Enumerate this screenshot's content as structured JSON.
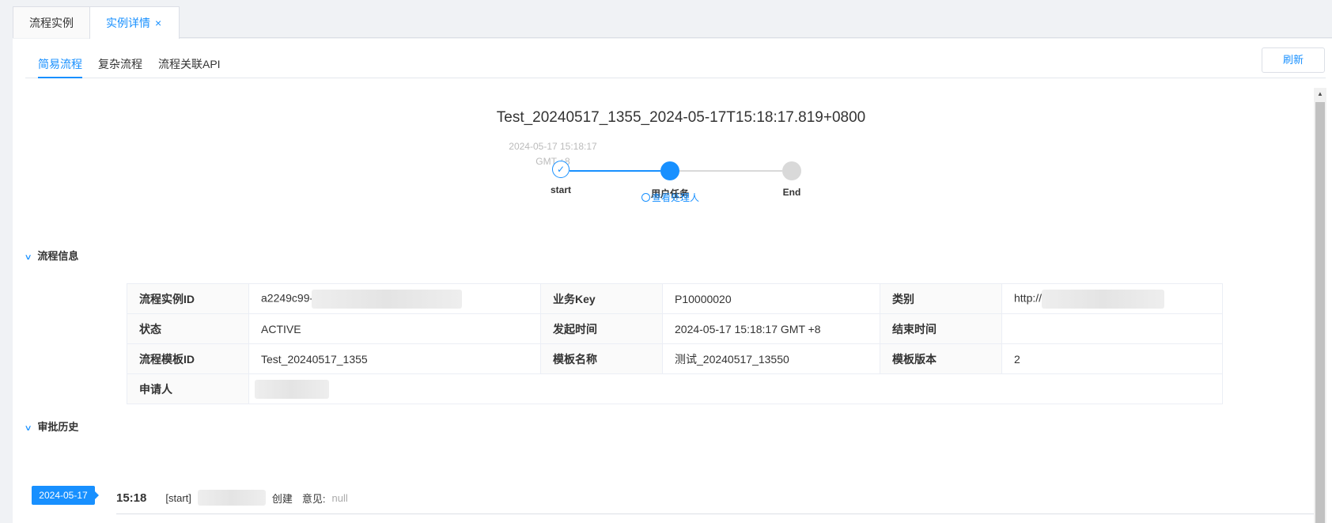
{
  "top_tabs": [
    {
      "label": "流程实例"
    },
    {
      "label": "实例详情",
      "close": "×"
    }
  ],
  "sub_tabs": [
    {
      "label": "简易流程"
    },
    {
      "label": "复杂流程"
    },
    {
      "label": "流程关联API"
    }
  ],
  "refresh_label": "刷新",
  "flow": {
    "title": "Test_20240517_1355_2024-05-17T15:18:17.819+0800",
    "start_time": "2024-05-17 15:18:17 GMT +8",
    "nodes": [
      {
        "label": "start",
        "status": "done"
      },
      {
        "label": "用户任务",
        "status": "active"
      },
      {
        "label": "End",
        "status": "pending"
      }
    ],
    "view_handler": "查看处理人"
  },
  "section_info": {
    "title": "流程信息"
  },
  "info": {
    "instance_id_label": "流程实例ID",
    "instance_id": "a2249c99-",
    "biz_key_label": "业务Key",
    "biz_key": "P10000020",
    "category_label": "类别",
    "category": "http://",
    "status_label": "状态",
    "status": "ACTIVE",
    "start_time_label": "发起时间",
    "start_time": "2024-05-17 15:18:17 GMT +8",
    "end_time_label": "结束时间",
    "end_time": "",
    "template_id_label": "流程模板ID",
    "template_id": "Test_20240517_1355",
    "template_name_label": "模板名称",
    "template_name": "测试_20240517_13550",
    "template_version_label": "模板版本",
    "template_version": "2",
    "applicant_label": "申请人"
  },
  "section_history": {
    "title": "审批历史"
  },
  "history": {
    "date": "2024-05-17",
    "time": "15:18",
    "node": "[start]",
    "action": "创建",
    "opinion_label": "意见:",
    "opinion": "null"
  },
  "colors": {
    "accent": "#1890ff",
    "pending": "#d9d9d9"
  }
}
